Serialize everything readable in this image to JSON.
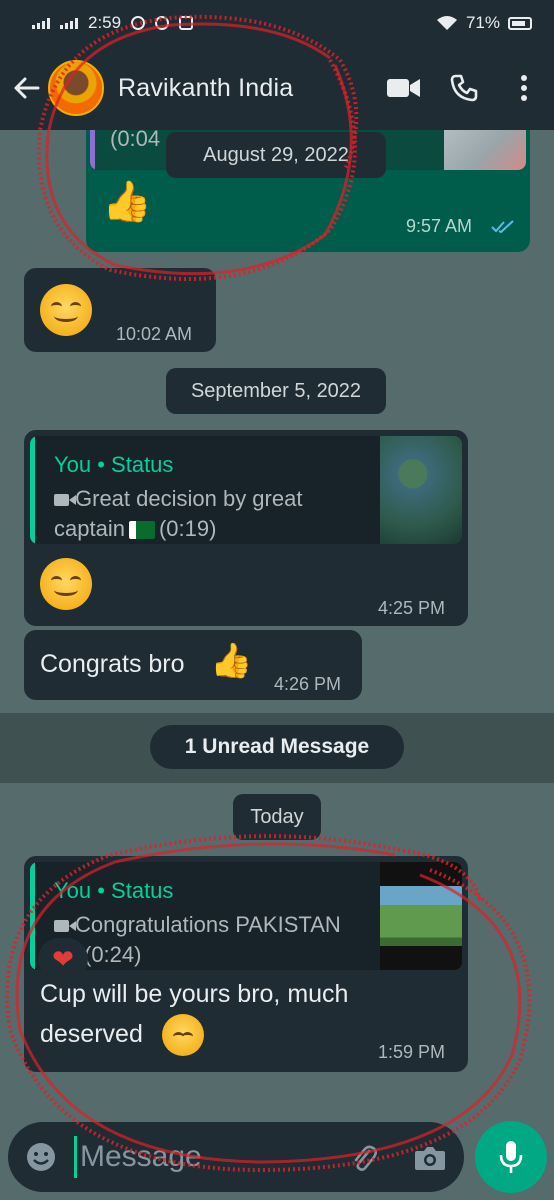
{
  "status_bar": {
    "time": "2:59",
    "battery": "71%"
  },
  "header": {
    "contact_name": "Ravikanth India"
  },
  "messages": {
    "msg1": {
      "partial_duration": "(0:04",
      "time": "9:57 AM"
    },
    "date1": "August 29, 2022",
    "msg2": {
      "time": "10:02 AM"
    },
    "date2": "September 5, 2022",
    "msg3": {
      "quote_author": "You • Status",
      "quote_line1": "Great decision by great",
      "quote_line2_prefix": "captain",
      "quote_duration": "(0:19)",
      "time": "4:25 PM"
    },
    "msg4": {
      "text": "Congrats bro",
      "time": "4:26 PM"
    },
    "unread": "1 Unread Message",
    "date3": "Today",
    "msg5": {
      "quote_author": "You • Status",
      "quote_line1": "Congratulations PAKISTAN",
      "quote_duration": "(0:24)",
      "text_line1": "Cup will be yours bro, much",
      "text_line2": "deserved",
      "time": "1:59 PM"
    }
  },
  "composer": {
    "placeholder": "Message"
  },
  "icons": {
    "back": "arrow-left",
    "video": "video-camera",
    "call": "phone",
    "menu": "more-vertical",
    "emoji": "smiley",
    "attach": "paperclip",
    "camera": "camera",
    "mic": "microphone"
  },
  "colors": {
    "header_bg": "#1f2c34",
    "chat_bg": "#566b6b",
    "incoming_bubble": "#1f2c34",
    "outgoing_bubble": "#005c4b",
    "accent": "#06cf9c",
    "mic_button": "#00a884",
    "annotation": "#e0202a"
  }
}
